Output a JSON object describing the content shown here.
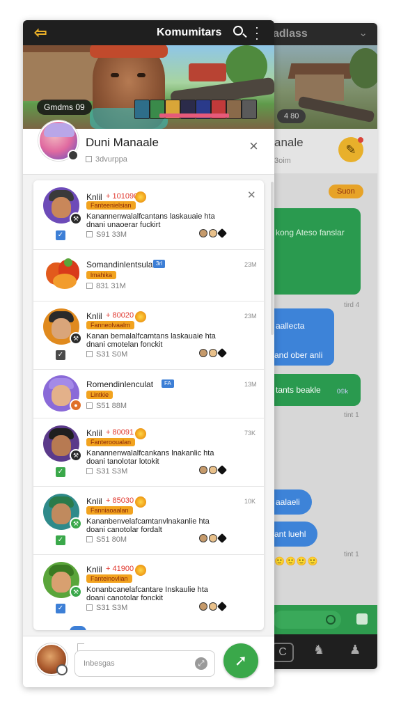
{
  "back_panel": {
    "title": "adlass",
    "banner_count": "4 80",
    "name": "anale",
    "subtitle": "3oim",
    "badge": "Suon",
    "messages": [
      {
        "text": "kong Ateso fanslar",
        "time": "tird 4"
      },
      {
        "text": "aallecta",
        "text2": "and ober anli"
      },
      {
        "text": "tants beakle",
        "extra": "0©k"
      },
      {
        "time": "tint 1"
      },
      {
        "text": "aalaeli"
      },
      {
        "text": "ant luehl"
      },
      {
        "time": "tint 1"
      }
    ]
  },
  "header": {
    "back_label": "back",
    "title": "Komumitars",
    "search_label": "search",
    "more_label": "more"
  },
  "banner": {
    "label": "Gmdms 09"
  },
  "profile": {
    "name": "Duni Manaale",
    "subtitle": "3dvurppa",
    "close_label": "×"
  },
  "rows": [
    {
      "type": "post",
      "title": "Knlil",
      "number": "+ 101090",
      "tag": "Fanteenielsian",
      "desc": "Kanannenwalalfcantans laskauaie hta dnani unaoerar fuckirt",
      "meta": "S91 33M",
      "time": "",
      "closable": true,
      "check": "blue",
      "avatar_color": "#6d4bb8"
    },
    {
      "type": "group",
      "title": "Somandinlentsulat",
      "blue": "3rl",
      "tag": "lmahika",
      "meta": "831 31M",
      "time": "23M"
    },
    {
      "type": "post",
      "title": "Knlil",
      "number": "+ 80020",
      "tag": "Fanneolvaalrn",
      "desc": "Kanan bemalalfcamtans laskauaie hta dnani cmotelan fonckit",
      "meta": "S31 S0M",
      "time": "23M",
      "check": "dark",
      "avatar_color": "#e08a1e"
    },
    {
      "type": "group",
      "title": "Romendinlenculat",
      "blue": "FA",
      "tag": "Lintkie",
      "meta": "S51 88M",
      "time": "13M"
    },
    {
      "type": "post",
      "title": "Knlil",
      "number": "+ 80091",
      "tag": "Fanterooualan",
      "desc": "Kanannenwalalfcankans lnakanlic hta doani tanolotar lotokit",
      "meta": "S31 S3M",
      "time": "73K",
      "check": "green",
      "avatar_color": "#5b3a8a"
    },
    {
      "type": "post",
      "title": "Knlil",
      "number": "+ 85030",
      "tag": "Fanniaoaalan",
      "desc": "Kananbenvelafcamtanvlnakanlie hta doani canotolar fordalt",
      "meta": "S51 80M",
      "time": "10K",
      "check": "green",
      "avatar_color": "#2f8a8a"
    },
    {
      "type": "post",
      "title": "Knlil",
      "number": "+ 41900",
      "tag": "Fanteinovlian",
      "desc": "Konanbcanelafcantare Inskaulie hta doani canotolar fonckit",
      "meta": "S31 S3M",
      "time": "",
      "check": "blue",
      "avatar_color": "#5aa53a"
    }
  ],
  "composer": {
    "placeholder": "Inbesgas",
    "send_label": "send"
  },
  "colors": {
    "header_bg": "#1f1f1f",
    "accent_orange": "#f2a31f",
    "send_green": "#3aa84a",
    "check_blue": "#3d7fd6",
    "check_green": "#3aa84a"
  }
}
